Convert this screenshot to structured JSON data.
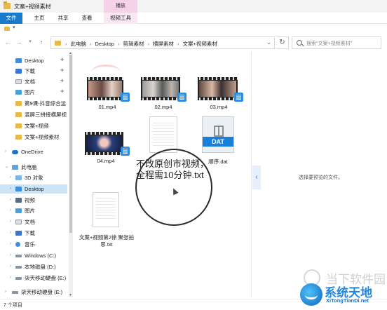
{
  "window": {
    "title": "文案+视频素材",
    "context_tab_header": "播放"
  },
  "ribbon": {
    "tabs": [
      "文件",
      "主页",
      "共享",
      "查看",
      "视频工具"
    ],
    "file_color": "#1979ca",
    "context_color": "#f6d2e9"
  },
  "address": {
    "crumbs": [
      "此电脑",
      "Desktop",
      "剪辑素材",
      "横屏素材",
      "文案+视频素材"
    ],
    "search_placeholder": "搜索\"文案+视频素材\""
  },
  "nav": {
    "items": [
      {
        "label": "Desktop",
        "icon": "desktop-icon",
        "pinned": true
      },
      {
        "label": "下载",
        "icon": "download-icon",
        "pinned": true
      },
      {
        "label": "文档",
        "icon": "documents-icon",
        "pinned": true
      },
      {
        "label": "图片",
        "icon": "pictures-icon",
        "pinned": true
      },
      {
        "label": "第9课-抖音综合运",
        "icon": "folder-icon",
        "pinned": false
      },
      {
        "label": "竖屏三拼接横屏视",
        "icon": "folder-icon",
        "pinned": false
      },
      {
        "label": "文案+视频",
        "icon": "folder-icon",
        "pinned": false
      },
      {
        "label": "文案+视频素材",
        "icon": "folder-icon",
        "pinned": false
      },
      {
        "label": "OneDrive",
        "icon": "onedrive-icon",
        "pinned": false
      },
      {
        "label": "此电脑",
        "icon": "computer-icon",
        "pinned": false
      },
      {
        "label": "3D 对象",
        "icon": "3d-objects-icon",
        "pinned": false
      },
      {
        "label": "Desktop",
        "icon": "desktop-icon",
        "pinned": false,
        "selected": true
      },
      {
        "label": "视频",
        "icon": "videos-icon",
        "pinned": false
      },
      {
        "label": "图片",
        "icon": "pictures-icon",
        "pinned": false
      },
      {
        "label": "文档",
        "icon": "documents-icon",
        "pinned": false
      },
      {
        "label": "下载",
        "icon": "download-icon",
        "pinned": false
      },
      {
        "label": "音乐",
        "icon": "music-icon",
        "pinned": false
      },
      {
        "label": "Windows (C:)",
        "icon": "drive-icon",
        "pinned": false
      },
      {
        "label": "本地磁盘 (D:)",
        "icon": "drive-icon",
        "pinned": false
      },
      {
        "label": "柒天移动硬盘 (E:)",
        "icon": "drive-icon",
        "pinned": false
      },
      {
        "label": "柒天移动硬盘 (E:)",
        "icon": "drive-icon",
        "pinned": false
      }
    ]
  },
  "files": [
    {
      "name": "01.mp4",
      "type": "video"
    },
    {
      "name": "02.mp4",
      "type": "video"
    },
    {
      "name": "03.mp4",
      "type": "video"
    },
    {
      "name": "04.mp4",
      "type": "video"
    },
    {
      "name": "不改原创市视频，全程需10分钟.txt",
      "type": "text"
    },
    {
      "name": "顺序.dat",
      "type": "dat",
      "badge": "DAT"
    },
    {
      "name": "文案+视频第2徐 聚张拍思.txt",
      "type": "text"
    }
  ],
  "zoom_text": "不改原创市视频，全程需10分钟.txt",
  "preview": {
    "message": "选择要预览的文件。"
  },
  "status": {
    "item_count": "7 个项目"
  },
  "watermarks": {
    "brand1": "当下软件园",
    "brand2": "系统天地",
    "brand2_url": "XiTongTianDi.net"
  }
}
